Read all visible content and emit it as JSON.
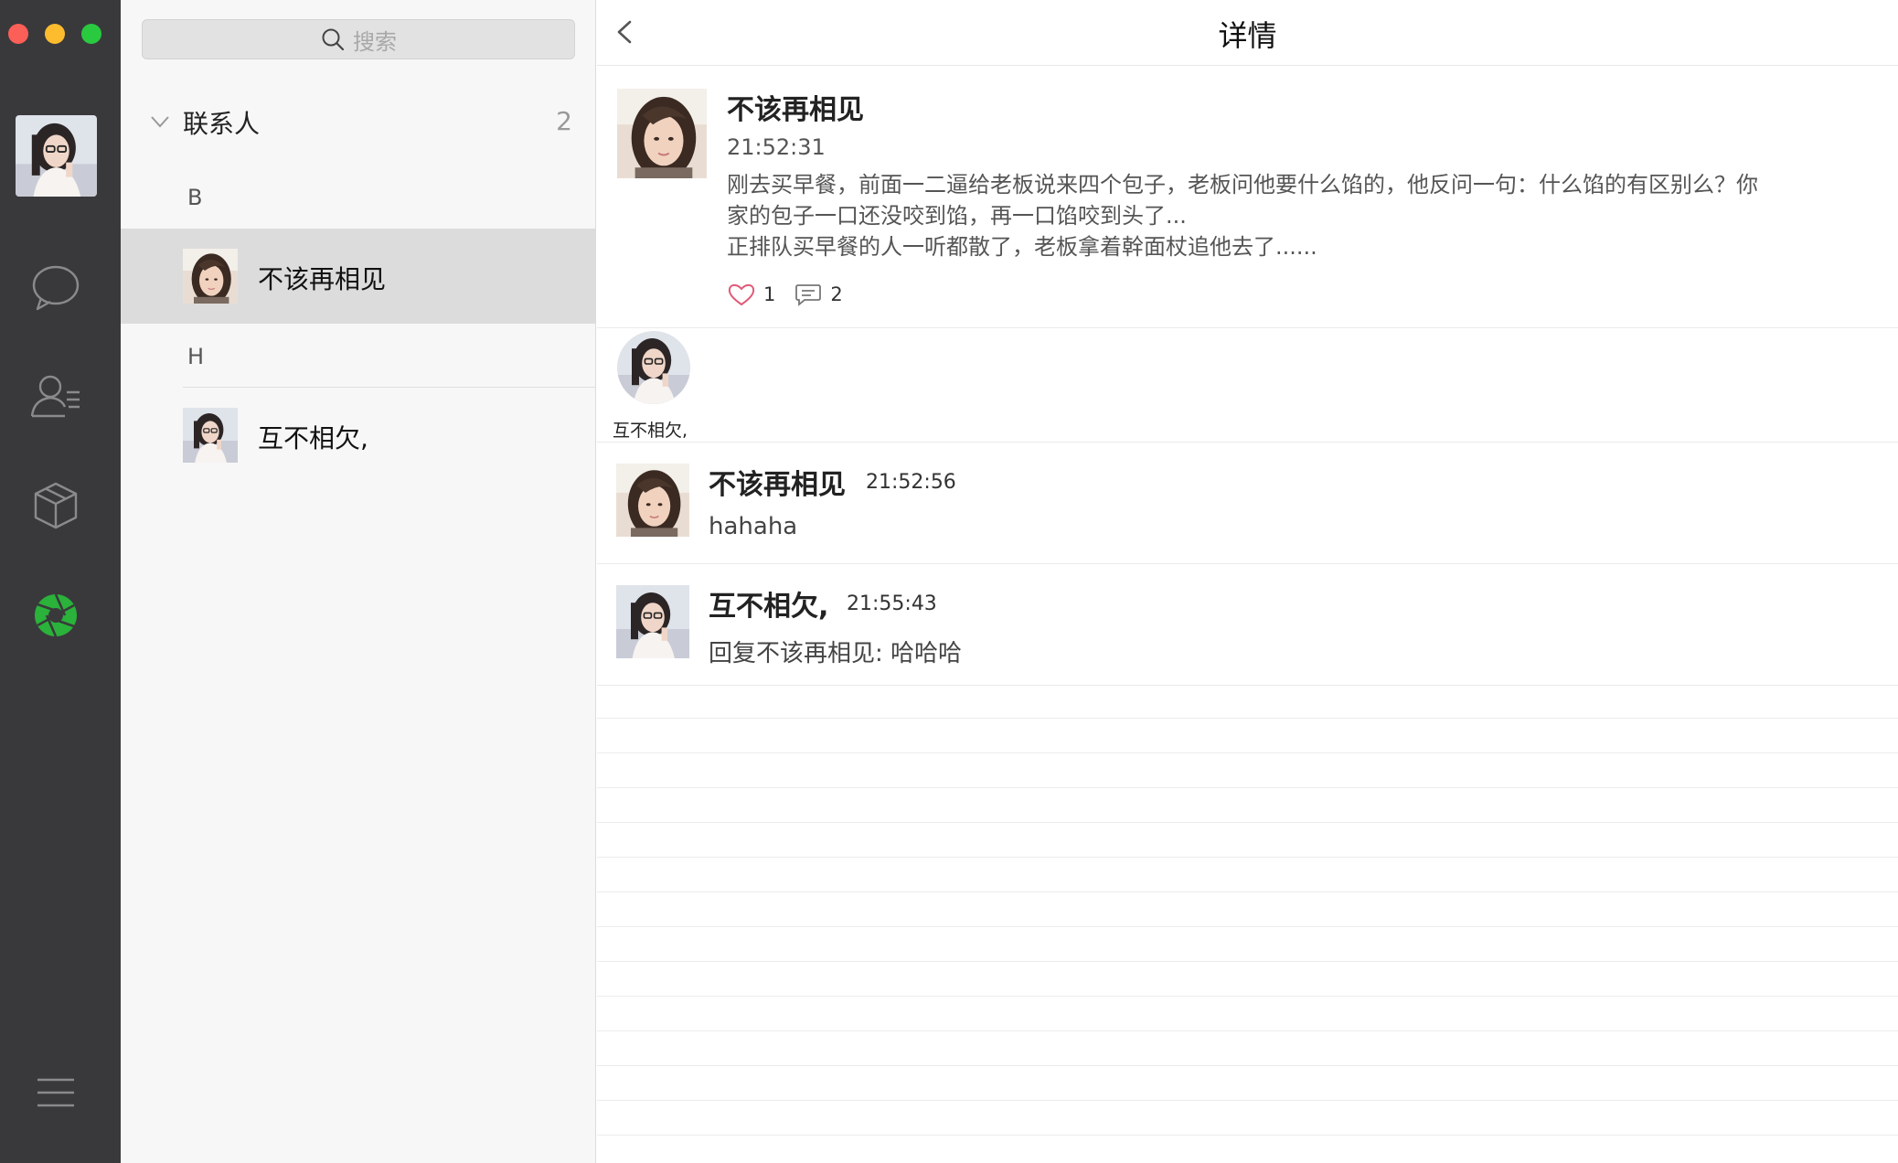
{
  "window_controls": {
    "close": "close",
    "minimize": "minimize",
    "maximize": "maximize"
  },
  "rail": {
    "items": [
      {
        "name": "chat-icon"
      },
      {
        "name": "contacts-icon"
      },
      {
        "name": "box-icon"
      },
      {
        "name": "moments-aperture-icon",
        "active_color": "#2ab23a"
      },
      {
        "name": "menu-icon"
      }
    ]
  },
  "search": {
    "placeholder": "搜索"
  },
  "contacts_group": {
    "title": "联系人",
    "count": "2"
  },
  "sections": [
    {
      "letter": "B",
      "contacts": [
        {
          "name": "不该再相见",
          "selected": true
        }
      ]
    },
    {
      "letter": "H",
      "contacts": [
        {
          "name": "互不相欠,",
          "selected": false
        }
      ]
    }
  ],
  "detail": {
    "title": "详情",
    "post": {
      "author": "不该再相见",
      "time": "21:52:31",
      "body": "刚去买早餐，前面一二逼给老板说来四个包子，老板问他要什么馅的，他反问一句：什么馅的有区别么？你\n家的包子一口还没咬到馅，再一口馅咬到头了...\n正排队买早餐的人一听都散了，老板拿着幹面杖追他去了......",
      "likes": "1",
      "comments": "2"
    },
    "liked_by": [
      {
        "name": "互不相欠,"
      }
    ],
    "comment_list": [
      {
        "author": "不该再相见",
        "time": "21:52:56",
        "text": "hahaha"
      },
      {
        "author": "互不相欠,",
        "time": "21:55:43",
        "text": "回复不该再相见: 哈哈哈"
      }
    ]
  },
  "colors": {
    "rail_bg": "#39393c",
    "list_bg": "#f7f7f7",
    "selected_bg": "#dcdcdc",
    "like_heart": "#e05a78"
  }
}
